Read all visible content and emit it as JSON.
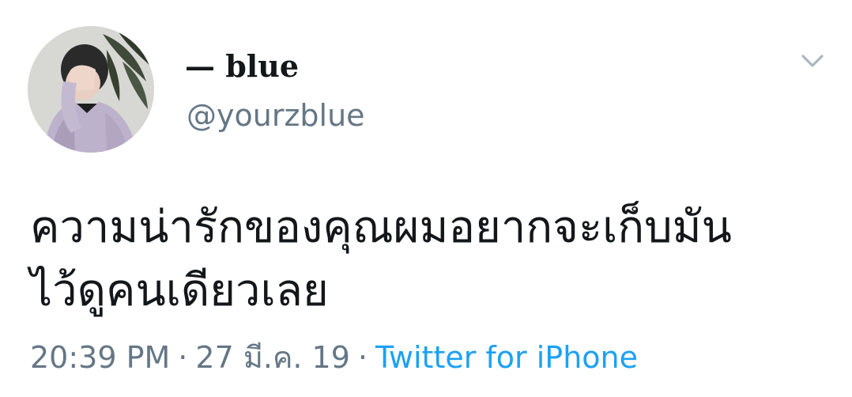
{
  "author": {
    "display_name": "— blue",
    "handle": "@yourzblue",
    "avatar_icon": "profile-photo"
  },
  "tweet": {
    "text_lines": [
      "ความน่ารักของคุณผมอยากจะเก็บมัน",
      "ไว้ดูคนเดียวเลย"
    ],
    "time": "20:39 PM",
    "separator": "·",
    "date": "27 มี.ค. 19",
    "source": "Twitter for iPhone"
  },
  "menu": {
    "icon": "chevron-down-icon"
  },
  "colors": {
    "text": "#14171a",
    "secondary": "#657786",
    "link": "#1da1f2",
    "background": "#ffffff"
  }
}
